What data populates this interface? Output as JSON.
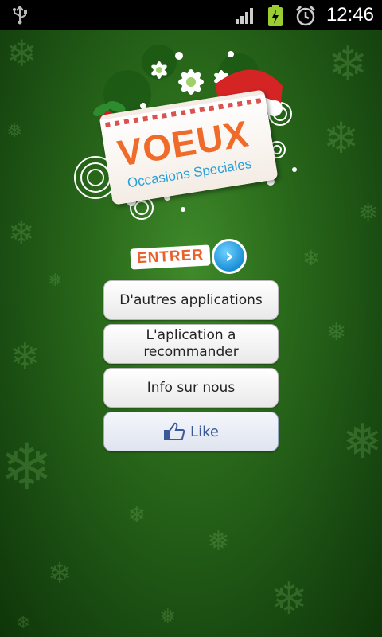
{
  "status_bar": {
    "time": "12:46",
    "icons": [
      "usb-icon",
      "signal-icon",
      "battery-charging-icon",
      "alarm-icon"
    ]
  },
  "logo": {
    "title": "VOEUX",
    "subtitle": "Occasions Speciales"
  },
  "enter": {
    "label": "ENTRER"
  },
  "menu": {
    "other_apps": "D'autres applications",
    "recommend": "L'aplication a recommander",
    "about": "Info sur nous",
    "like": "Like"
  },
  "colors": {
    "background": "#2a6a1b",
    "title_orange": "#f06a2a",
    "subtitle_blue": "#2aa0d8",
    "facebook_blue": "#3b5998"
  }
}
